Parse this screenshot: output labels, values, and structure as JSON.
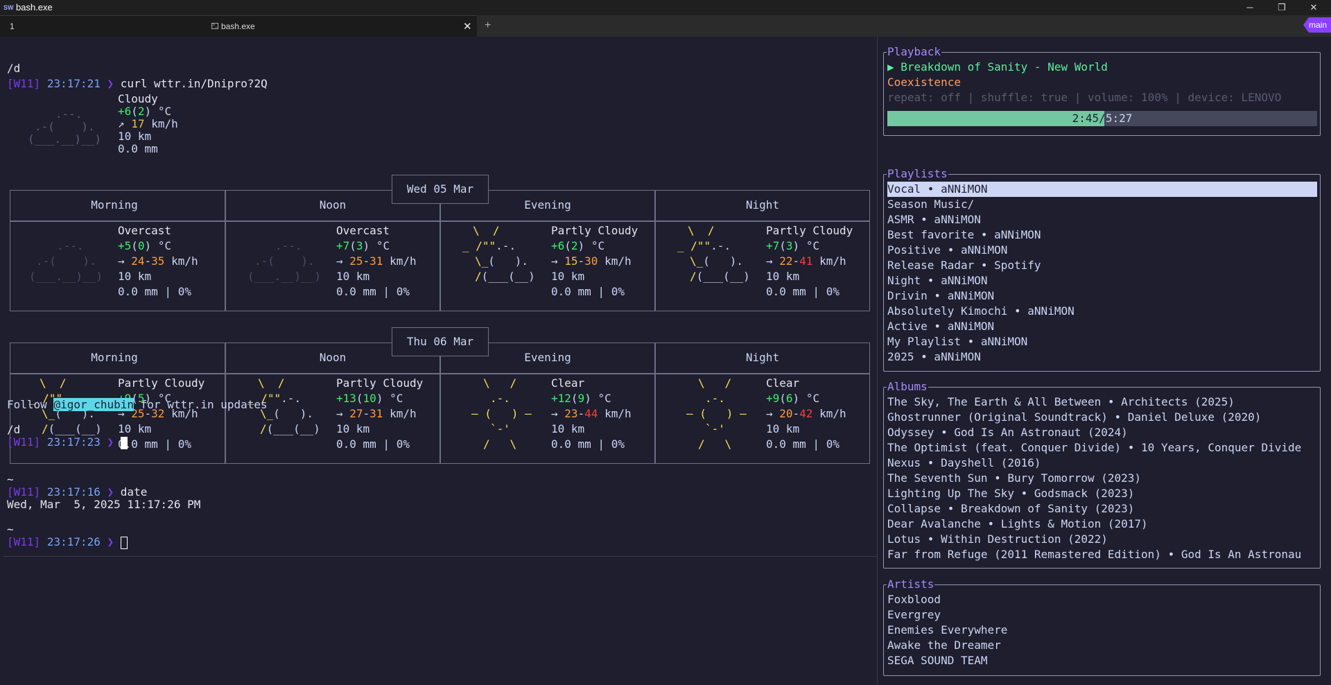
{
  "window": {
    "title": "bash.exe",
    "app_icon": "SW"
  },
  "tabs": {
    "pane_label": "1",
    "active_label": "bash.exe",
    "new_tab": "+",
    "close": "✕",
    "badge": "main"
  },
  "terminal": {
    "cwd1": "/d",
    "prompt_tag": "[W11]",
    "time1": "23:17:21",
    "prompt_arrow": "❯",
    "cmd1": "curl wttr.in/Dnipro?2Q",
    "current": {
      "art": [
        ".--.",
        ".-(    ).",
        "(___.__)__)"
      ],
      "condition": "Cloudy",
      "temp_a": "+6",
      "temp_b": "2",
      "temp_unit": "°C",
      "wind_arrow": "↗",
      "wind": "17",
      "wind_unit": "km/h",
      "visibility": "10 km",
      "precip": "0.0 mm"
    },
    "days": [
      {
        "date": "Wed 05 Mar",
        "periods": [
          {
            "name": "Morning",
            "cond": "Overcast",
            "t1": "+5",
            "t2": "0",
            "w1": "24",
            "w2": "35",
            "vis": "10 km",
            "precip": "0.0 mm | 0%",
            "art": [
              "",
              ".--.",
              ".-(    ).",
              "(___.__)__)",
              ""
            ]
          },
          {
            "name": "Noon",
            "cond": "Overcast",
            "t1": "+7",
            "t2": "3",
            "w1": "25",
            "w2": "31",
            "vis": "10 km",
            "precip": "0.0 mm | 0%",
            "art": [
              "",
              ".--.",
              ".-(    ).",
              "(___.__)__)",
              ""
            ]
          },
          {
            "name": "Evening",
            "cond": "Partly Cloudy",
            "t1": "+6",
            "t2": "2",
            "w1": "15",
            "w2": "30",
            "vis": "10 km",
            "precip": "0.0 mm | 0%",
            "art": [
              "\\  /",
              "_ /\"\".-.",
              "\\_(   ).",
              "/(___(__)",
              ""
            ]
          },
          {
            "name": "Night",
            "cond": "Partly Cloudy",
            "t1": "+7",
            "t2": "3",
            "w1": "22",
            "w2": "41",
            "vis": "10 km",
            "precip": "0.0 mm | 0%",
            "art": [
              "\\  /",
              "_ /\"\".-.",
              "\\_(   ).",
              "/(___(__)",
              ""
            ]
          }
        ]
      },
      {
        "date": "Thu 06 Mar",
        "periods": [
          {
            "name": "Morning",
            "cond": "Partly Cloudy",
            "t1": "+9",
            "t2": "5",
            "w1": "25",
            "w2": "32",
            "vis": "10 km",
            "precip": "0.0 mm | 0%",
            "art": [
              "\\  /",
              "_ /\"\".-.",
              "\\_(   ).",
              "/(___(__)",
              ""
            ]
          },
          {
            "name": "Noon",
            "cond": "Partly Cloudy",
            "t1": "+13",
            "t2": "10",
            "w1": "27",
            "w2": "31",
            "vis": "10 km",
            "precip": "0.0 mm | 0%",
            "art": [
              "\\  /",
              "_ /\"\".-.",
              "\\_(   ).",
              "/(___(__)",
              ""
            ]
          },
          {
            "name": "Evening",
            "cond": "Clear",
            "t1": "+12",
            "t2": "9",
            "w1": "23",
            "w2": "44",
            "vis": "10 km",
            "precip": "0.0 mm | 0%",
            "art": [
              "\\   /",
              ".-.",
              "― (   ) ―",
              "`-'",
              "/   \\"
            ]
          },
          {
            "name": "Night",
            "cond": "Clear",
            "t1": "+9",
            "t2": "6",
            "w1": "20",
            "w2": "42",
            "vis": "10 km",
            "precip": "0.0 mm | 0%",
            "art": [
              "\\   /",
              ".-.",
              "― (   ) ―",
              "`-'",
              "/   \\"
            ]
          }
        ]
      }
    ],
    "temp_unit": "°C",
    "wind_arrow": "→",
    "wind_unit": "km/h",
    "follow_prefix": "Follow ",
    "follow_handle": "@igor_chubin",
    "follow_suffix": " for wttr.in updates",
    "cwd2": "/d",
    "time2": "23:17:23",
    "cwd3": "~",
    "time3": "23:17:16",
    "cmd3": "date",
    "date_output": "Wed, Mar  5, 2025 11:17:26 PM",
    "cwd4": "~",
    "time4": "23:17:26"
  },
  "spotify": {
    "playback": {
      "title": "Playback",
      "track": "▶ Breakdown of Sanity - New World",
      "album": "Coexistence",
      "status": "repeat: off | shuffle: true | volume: 100% | device: LENOVO",
      "elapsed": "2:45",
      "duration": "5:27",
      "progress": 0.505
    },
    "playlists": {
      "title": "Playlists",
      "items": [
        "Vocal • aNNiMON",
        "Season Music/",
        "ASMR • aNNiMON",
        "Best favorite • aNNiMON",
        "Positive • aNNiMON",
        "Release Radar • Spotify",
        "Night • aNNiMON",
        "Drivin • aNNiMON",
        "Absolutely Kimochi • aNNiMON",
        "Active • aNNiMON",
        "My Playlist • aNNiMON",
        "2025 • aNNiMON"
      ]
    },
    "albums": {
      "title": "Albums",
      "items": [
        "The Sky, The Earth & All Between • Architects (2025)",
        "Ghostrunner (Original Soundtrack) • Daniel Deluxe (2020)",
        "Odyssey • God Is An Astronaut (2024)",
        "The Optimist (feat. Conquer Divide) • 10 Years, Conquer Divide",
        "Nexus • Dayshell (2016)",
        "The Seventh Sun • Bury Tomorrow (2023)",
        "Lighting Up The Sky • Godsmack (2023)",
        "Collapse • Breakdown of Sanity (2023)",
        "Dear Avalanche • Lights & Motion (2017)",
        "Lotus • Within Destruction (2022)",
        "Far from Refuge (2011 Remastered Edition) • God Is An Astronau"
      ]
    },
    "artists": {
      "title": "Artists",
      "items": [
        "Foxblood",
        "Evergrey",
        "Enemies Everywhere",
        "Awake the Dreamer",
        "SEGA SOUND TEAM"
      ]
    }
  }
}
